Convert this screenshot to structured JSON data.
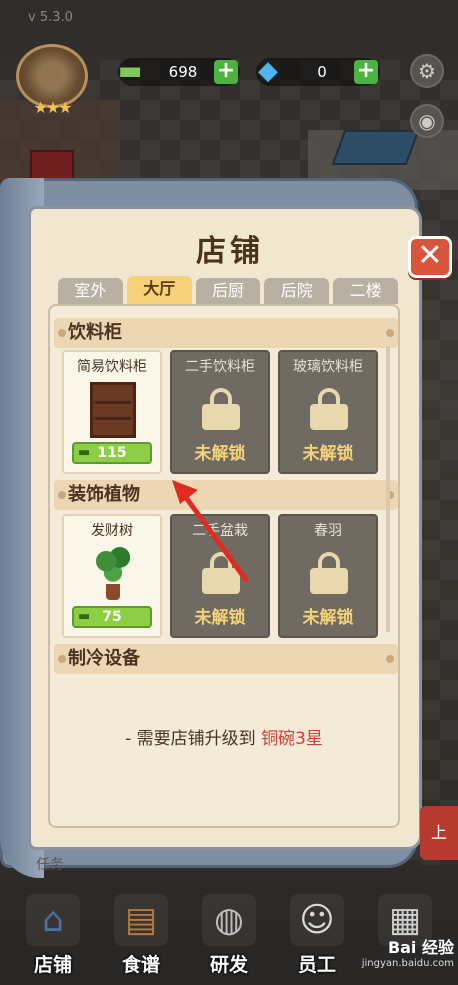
{
  "app": {
    "version": "v 5.3.0"
  },
  "currency": {
    "cash_value": "698",
    "gem_value": "0",
    "add_symbol": "+",
    "cash_icon": "cash-icon",
    "gem_icon": "gem-icon"
  },
  "panel": {
    "title": "店铺",
    "close_symbol": "✕",
    "tabs": [
      {
        "label": "室外",
        "active": false
      },
      {
        "label": "大厅",
        "active": true
      },
      {
        "label": "后厨",
        "active": false
      },
      {
        "label": "后院",
        "active": false
      },
      {
        "label": "二楼",
        "active": false
      }
    ],
    "sections": [
      {
        "title": "饮料柜",
        "items": [
          {
            "name": "简易饮料柜",
            "status": "unlocked",
            "price": "115"
          },
          {
            "name": "二手饮料柜",
            "status": "locked",
            "locked_text": "未解锁"
          },
          {
            "name": "玻璃饮料柜",
            "status": "locked",
            "locked_text": "未解锁"
          }
        ]
      },
      {
        "title": "装饰植物",
        "items": [
          {
            "name": "发财树",
            "status": "unlocked",
            "price": "75"
          },
          {
            "name": "二手盆栽",
            "status": "locked",
            "locked_text": "未解锁"
          },
          {
            "name": "春羽",
            "status": "locked",
            "locked_text": "未解锁"
          }
        ]
      },
      {
        "title": "制冷设备",
        "note_prefix": "- 需要店铺升级到",
        "note_highlight": "铜碗3星"
      }
    ]
  },
  "bottom_nav": {
    "task_label": "任务",
    "items": [
      {
        "label": "店铺",
        "icon": "store-icon"
      },
      {
        "label": "食谱",
        "icon": "recipe-book-icon"
      },
      {
        "label": "研发",
        "icon": "cooking-pot-icon"
      },
      {
        "label": "员工",
        "icon": "staff-icon"
      },
      {
        "label": "",
        "icon": "more-icon"
      }
    ]
  },
  "side_tag": "上",
  "watermark": {
    "main": "Bai 经验",
    "sub": "jingyan.baidu.com"
  },
  "colors": {
    "accent_green": "#8ccf45",
    "locked_gold": "#f3d37a",
    "highlight_red": "#d0413a",
    "close_red": "#d8553c"
  }
}
